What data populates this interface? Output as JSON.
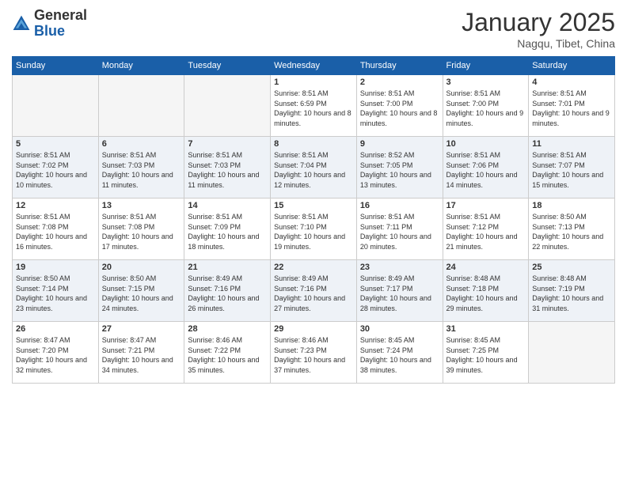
{
  "header": {
    "logo_general": "General",
    "logo_blue": "Blue",
    "month_title": "January 2025",
    "subtitle": "Nagqu, Tibet, China"
  },
  "weekdays": [
    "Sunday",
    "Monday",
    "Tuesday",
    "Wednesday",
    "Thursday",
    "Friday",
    "Saturday"
  ],
  "weeks": [
    [
      {
        "day": "",
        "sunrise": "",
        "sunset": "",
        "daylight": ""
      },
      {
        "day": "",
        "sunrise": "",
        "sunset": "",
        "daylight": ""
      },
      {
        "day": "",
        "sunrise": "",
        "sunset": "",
        "daylight": ""
      },
      {
        "day": "1",
        "sunrise": "Sunrise: 8:51 AM",
        "sunset": "Sunset: 6:59 PM",
        "daylight": "Daylight: 10 hours and 8 minutes."
      },
      {
        "day": "2",
        "sunrise": "Sunrise: 8:51 AM",
        "sunset": "Sunset: 7:00 PM",
        "daylight": "Daylight: 10 hours and 8 minutes."
      },
      {
        "day": "3",
        "sunrise": "Sunrise: 8:51 AM",
        "sunset": "Sunset: 7:00 PM",
        "daylight": "Daylight: 10 hours and 9 minutes."
      },
      {
        "day": "4",
        "sunrise": "Sunrise: 8:51 AM",
        "sunset": "Sunset: 7:01 PM",
        "daylight": "Daylight: 10 hours and 9 minutes."
      }
    ],
    [
      {
        "day": "5",
        "sunrise": "Sunrise: 8:51 AM",
        "sunset": "Sunset: 7:02 PM",
        "daylight": "Daylight: 10 hours and 10 minutes."
      },
      {
        "day": "6",
        "sunrise": "Sunrise: 8:51 AM",
        "sunset": "Sunset: 7:03 PM",
        "daylight": "Daylight: 10 hours and 11 minutes."
      },
      {
        "day": "7",
        "sunrise": "Sunrise: 8:51 AM",
        "sunset": "Sunset: 7:03 PM",
        "daylight": "Daylight: 10 hours and 11 minutes."
      },
      {
        "day": "8",
        "sunrise": "Sunrise: 8:51 AM",
        "sunset": "Sunset: 7:04 PM",
        "daylight": "Daylight: 10 hours and 12 minutes."
      },
      {
        "day": "9",
        "sunrise": "Sunrise: 8:52 AM",
        "sunset": "Sunset: 7:05 PM",
        "daylight": "Daylight: 10 hours and 13 minutes."
      },
      {
        "day": "10",
        "sunrise": "Sunrise: 8:51 AM",
        "sunset": "Sunset: 7:06 PM",
        "daylight": "Daylight: 10 hours and 14 minutes."
      },
      {
        "day": "11",
        "sunrise": "Sunrise: 8:51 AM",
        "sunset": "Sunset: 7:07 PM",
        "daylight": "Daylight: 10 hours and 15 minutes."
      }
    ],
    [
      {
        "day": "12",
        "sunrise": "Sunrise: 8:51 AM",
        "sunset": "Sunset: 7:08 PM",
        "daylight": "Daylight: 10 hours and 16 minutes."
      },
      {
        "day": "13",
        "sunrise": "Sunrise: 8:51 AM",
        "sunset": "Sunset: 7:08 PM",
        "daylight": "Daylight: 10 hours and 17 minutes."
      },
      {
        "day": "14",
        "sunrise": "Sunrise: 8:51 AM",
        "sunset": "Sunset: 7:09 PM",
        "daylight": "Daylight: 10 hours and 18 minutes."
      },
      {
        "day": "15",
        "sunrise": "Sunrise: 8:51 AM",
        "sunset": "Sunset: 7:10 PM",
        "daylight": "Daylight: 10 hours and 19 minutes."
      },
      {
        "day": "16",
        "sunrise": "Sunrise: 8:51 AM",
        "sunset": "Sunset: 7:11 PM",
        "daylight": "Daylight: 10 hours and 20 minutes."
      },
      {
        "day": "17",
        "sunrise": "Sunrise: 8:51 AM",
        "sunset": "Sunset: 7:12 PM",
        "daylight": "Daylight: 10 hours and 21 minutes."
      },
      {
        "day": "18",
        "sunrise": "Sunrise: 8:50 AM",
        "sunset": "Sunset: 7:13 PM",
        "daylight": "Daylight: 10 hours and 22 minutes."
      }
    ],
    [
      {
        "day": "19",
        "sunrise": "Sunrise: 8:50 AM",
        "sunset": "Sunset: 7:14 PM",
        "daylight": "Daylight: 10 hours and 23 minutes."
      },
      {
        "day": "20",
        "sunrise": "Sunrise: 8:50 AM",
        "sunset": "Sunset: 7:15 PM",
        "daylight": "Daylight: 10 hours and 24 minutes."
      },
      {
        "day": "21",
        "sunrise": "Sunrise: 8:49 AM",
        "sunset": "Sunset: 7:16 PM",
        "daylight": "Daylight: 10 hours and 26 minutes."
      },
      {
        "day": "22",
        "sunrise": "Sunrise: 8:49 AM",
        "sunset": "Sunset: 7:16 PM",
        "daylight": "Daylight: 10 hours and 27 minutes."
      },
      {
        "day": "23",
        "sunrise": "Sunrise: 8:49 AM",
        "sunset": "Sunset: 7:17 PM",
        "daylight": "Daylight: 10 hours and 28 minutes."
      },
      {
        "day": "24",
        "sunrise": "Sunrise: 8:48 AM",
        "sunset": "Sunset: 7:18 PM",
        "daylight": "Daylight: 10 hours and 29 minutes."
      },
      {
        "day": "25",
        "sunrise": "Sunrise: 8:48 AM",
        "sunset": "Sunset: 7:19 PM",
        "daylight": "Daylight: 10 hours and 31 minutes."
      }
    ],
    [
      {
        "day": "26",
        "sunrise": "Sunrise: 8:47 AM",
        "sunset": "Sunset: 7:20 PM",
        "daylight": "Daylight: 10 hours and 32 minutes."
      },
      {
        "day": "27",
        "sunrise": "Sunrise: 8:47 AM",
        "sunset": "Sunset: 7:21 PM",
        "daylight": "Daylight: 10 hours and 34 minutes."
      },
      {
        "day": "28",
        "sunrise": "Sunrise: 8:46 AM",
        "sunset": "Sunset: 7:22 PM",
        "daylight": "Daylight: 10 hours and 35 minutes."
      },
      {
        "day": "29",
        "sunrise": "Sunrise: 8:46 AM",
        "sunset": "Sunset: 7:23 PM",
        "daylight": "Daylight: 10 hours and 37 minutes."
      },
      {
        "day": "30",
        "sunrise": "Sunrise: 8:45 AM",
        "sunset": "Sunset: 7:24 PM",
        "daylight": "Daylight: 10 hours and 38 minutes."
      },
      {
        "day": "31",
        "sunrise": "Sunrise: 8:45 AM",
        "sunset": "Sunset: 7:25 PM",
        "daylight": "Daylight: 10 hours and 39 minutes."
      },
      {
        "day": "",
        "sunrise": "",
        "sunset": "",
        "daylight": ""
      }
    ]
  ]
}
